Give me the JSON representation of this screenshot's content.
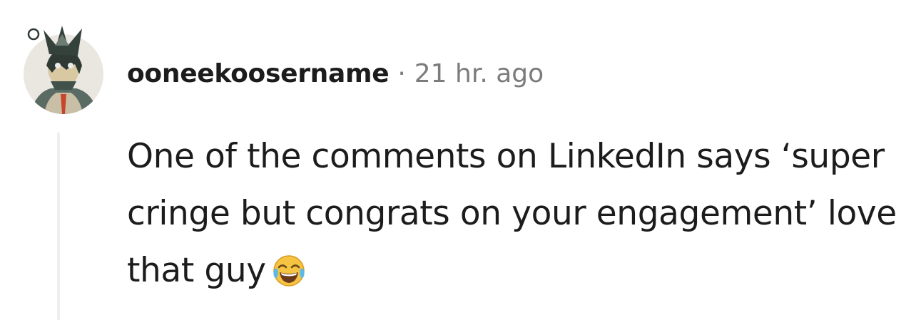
{
  "comment": {
    "author": "ooneekoosername",
    "separator": "·",
    "timestamp": "21 hr. ago",
    "body": "One of the comments on LinkedIn says ‘super cringe but congrats on your engagement’ love that guy",
    "emoji": "face-with-tears-of-joy-icon"
  }
}
